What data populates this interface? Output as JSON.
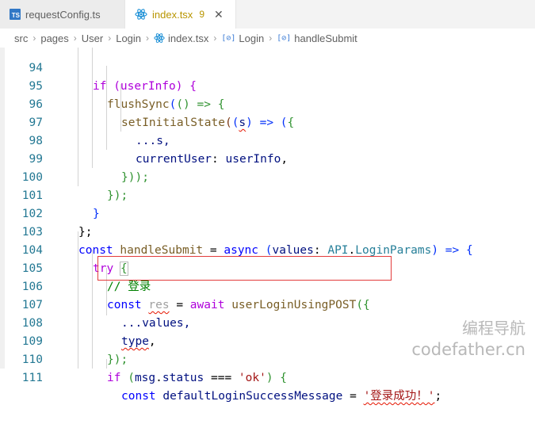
{
  "tabs": [
    {
      "badge": "TS",
      "title": "requestConfig.ts"
    },
    {
      "title": "index.tsx",
      "count": "9",
      "close": "✕"
    }
  ],
  "breadcrumb": [
    "src",
    "pages",
    "User",
    "Login",
    "index.tsx",
    "Login",
    "handleSubmit"
  ],
  "symbol_glyph": "[⊘]",
  "line_numbers": [
    "94",
    "95",
    "96",
    "97",
    "98",
    "99",
    "100",
    "101",
    "102",
    "103",
    "104",
    "105",
    "106",
    "107",
    "108",
    "109",
    "110",
    "111"
  ],
  "code": {
    "l94": "if (userInfo) {",
    "l95a": "flushSync",
    "l95b": "(",
    "l95c": "() => {",
    "l96a": "setInitialState",
    "l96b": "(",
    "l96c": "(",
    "l96d": "s",
    "l96e": ") => (",
    "l96f": "{",
    "l97": "...s,",
    "l98a": "currentUser",
    "l98b": ": ",
    "l98c": "userInfo",
    "l98d": ",",
    "l99": "}));",
    "l100": "});",
    "l101": "}",
    "l102": "};",
    "l103a": "const",
    "l103b": "handleSubmit",
    "l103c": " = ",
    "l103d": "async",
    "l103e": " (",
    "l103f": "values",
    "l103g": ": ",
    "l103h": "API",
    "l103i": ".",
    "l103j": "LoginParams",
    "l103k": ") => {",
    "l104a": "try",
    "l104b": "{",
    "l105": "// 登录",
    "l106a": "const",
    "l106b": "res",
    "l106c": " = ",
    "l106d": "await",
    "l106e": "userLoginUsingPOST",
    "l106f": "({",
    "l107": "...values,",
    "l108a": "type",
    "l108b": ",",
    "l109": "});",
    "l110a": "if",
    "l110b": " (",
    "l110c": "msg",
    "l110d": ".",
    "l110e": "status",
    "l110f": " === ",
    "l110g": "'ok'",
    "l110h": ") {",
    "l111a": "const",
    "l111b": "defaultLoginSuccessMessage",
    "l111c": " = ",
    "l111d": "'登录成功！'",
    "l111e": ";"
  },
  "watermark": {
    "line1": "编程导航",
    "line2": "codefather.cn"
  },
  "colors": {
    "highlight_box": "#e23b3b",
    "keyword": "#0000ff",
    "comment": "#008000",
    "string": "#a31515"
  }
}
